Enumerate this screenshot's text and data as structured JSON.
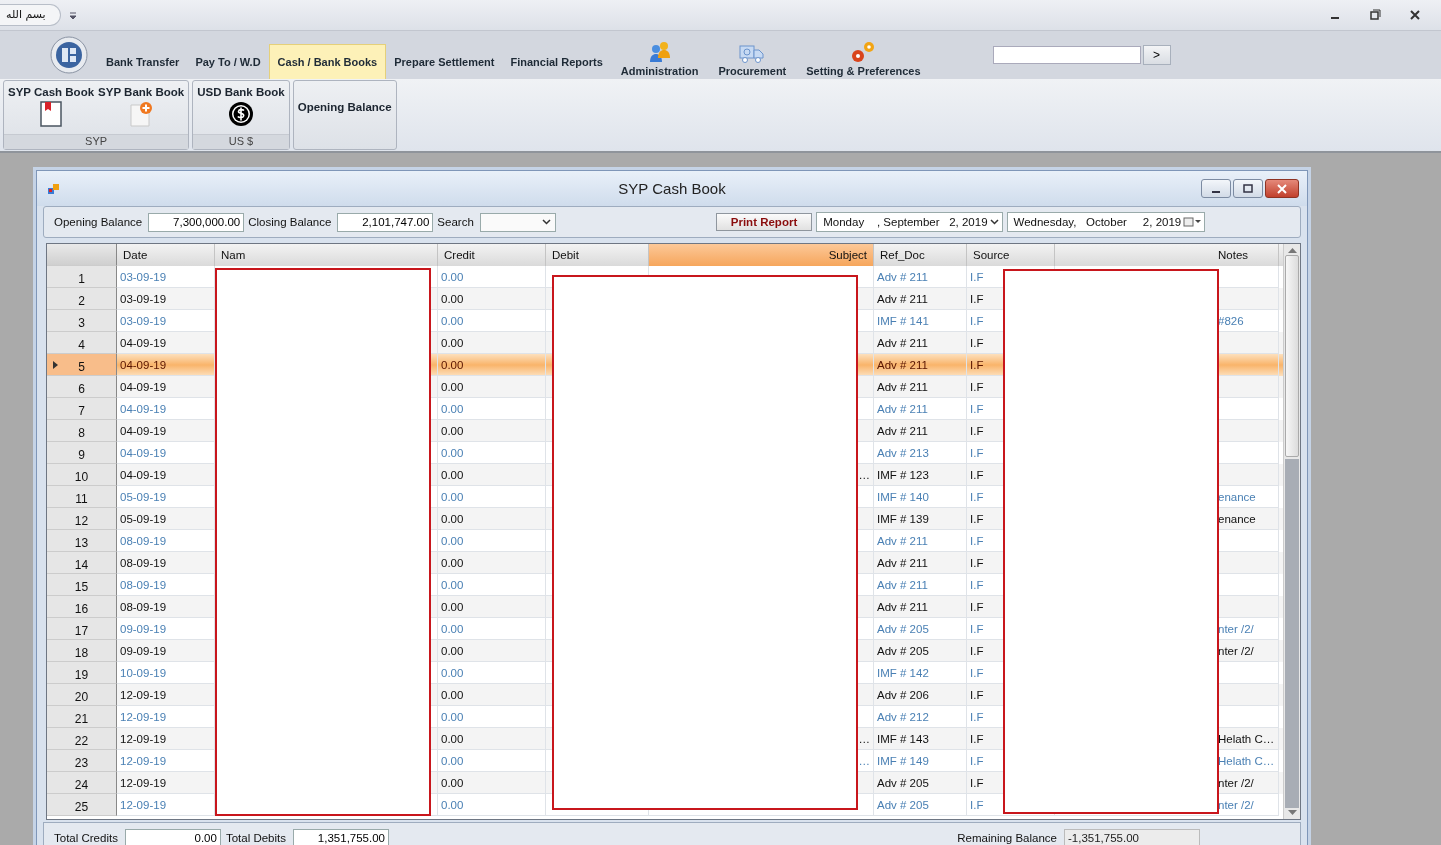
{
  "title_bar": {
    "quick_access": "بسم الله"
  },
  "ribbon": {
    "tabs": [
      {
        "label": "Bank Transfer",
        "selected": false,
        "kind": "text"
      },
      {
        "label": "Pay To / W.D",
        "selected": false,
        "kind": "text"
      },
      {
        "label": "Cash  / Bank Books",
        "selected": true,
        "kind": "text"
      },
      {
        "label": "Prepare Settlement",
        "selected": false,
        "kind": "text"
      },
      {
        "label": "Financial Reports",
        "selected": false,
        "kind": "text"
      },
      {
        "label": "Administration",
        "selected": false,
        "kind": "people"
      },
      {
        "label": "Procurement",
        "selected": false,
        "kind": "truck"
      },
      {
        "label": "Setting & Preferences",
        "selected": false,
        "kind": "gears"
      }
    ],
    "search_button": ">",
    "groups": [
      {
        "caption": "SYP",
        "buttons": [
          {
            "label": "SYP Cash Book",
            "kind": "book"
          },
          {
            "label": "SYP Bank Book",
            "kind": "page"
          }
        ]
      },
      {
        "caption": "US $",
        "buttons": [
          {
            "label": "USD Bank Book",
            "kind": "coin"
          }
        ]
      },
      {
        "buttons": [
          {
            "label": "Opening Balance",
            "kind": "text"
          }
        ]
      }
    ]
  },
  "child_window": {
    "title": "SYP Cash Book",
    "toolbar": {
      "opening_label": "Opening Balance",
      "opening_value": "7,300,000.00",
      "closing_label": "Closing  Balance",
      "closing_value": "2,101,747.00",
      "search_label": "Search",
      "print_button": "Print Report",
      "from_date": "Monday    , September   2, 2019",
      "to_date": "Wednesday,   October     2, 2019"
    },
    "columns": [
      {
        "label": "Date",
        "selected": false
      },
      {
        "label": "Nam",
        "selected": false
      },
      {
        "label": "Credit",
        "selected": false
      },
      {
        "label": "Debit",
        "selected": false
      },
      {
        "label": "Subject",
        "selected": true
      },
      {
        "label": "Ref_Doc",
        "selected": false
      },
      {
        "label": "Source",
        "selected": false
      },
      {
        "label": "Notes",
        "selected": false
      }
    ],
    "rows": [
      {
        "number": "1",
        "date": "03-09-19",
        "credit": "0.00",
        "ref_doc": "Adv # 211",
        "source": "I.F",
        "selected": false
      },
      {
        "number": "2",
        "date": "03-09-19",
        "credit": "0.00",
        "ref_doc": "Adv # 211",
        "source": "I.F",
        "selected": false
      },
      {
        "number": "3",
        "date": "03-09-19",
        "credit": "0.00",
        "ref_doc": "IMF # 141",
        "source": "I.F",
        "notes": "#826",
        "selected": false
      },
      {
        "number": "4",
        "date": "04-09-19",
        "credit": "0.00",
        "ref_doc": "Adv # 211",
        "source": "I.F",
        "selected": false
      },
      {
        "number": "5",
        "date": "04-09-19",
        "credit": "0.00",
        "ref_doc": "Adv # 211",
        "source": "I.F",
        "selected": true
      },
      {
        "number": "6",
        "date": "04-09-19",
        "credit": "0.00",
        "ref_doc": "Adv # 211",
        "source": "I.F",
        "selected": false
      },
      {
        "number": "7",
        "date": "04-09-19",
        "credit": "0.00",
        "ref_doc": "Adv # 211",
        "source": "I.F",
        "selected": false
      },
      {
        "number": "8",
        "date": "04-09-19",
        "credit": "0.00",
        "ref_doc": "Adv # 211",
        "source": "I.F",
        "selected": false
      },
      {
        "number": "9",
        "date": "04-09-19",
        "credit": "0.00",
        "ref_doc": "Adv # 213",
        "source": "I.F",
        "selected": false
      },
      {
        "number": "10",
        "date": "04-09-19",
        "credit": "0.00",
        "subject": "…",
        "ref_doc": "IMF # 123",
        "source": "I.F",
        "selected": false
      },
      {
        "number": "11",
        "date": "05-09-19",
        "credit": "0.00",
        "ref_doc": "IMF # 140",
        "source": "I.F",
        "notes": "enance",
        "selected": false
      },
      {
        "number": "12",
        "date": "05-09-19",
        "credit": "0.00",
        "ref_doc": "IMF # 139",
        "source": "I.F",
        "notes": "enance",
        "selected": false
      },
      {
        "number": "13",
        "date": "08-09-19",
        "credit": "0.00",
        "ref_doc": "Adv # 211",
        "source": "I.F",
        "selected": false
      },
      {
        "number": "14",
        "date": "08-09-19",
        "credit": "0.00",
        "ref_doc": "Adv # 211",
        "source": "I.F",
        "selected": false
      },
      {
        "number": "15",
        "date": "08-09-19",
        "credit": "0.00",
        "ref_doc": "Adv # 211",
        "source": "I.F",
        "selected": false
      },
      {
        "number": "16",
        "date": "08-09-19",
        "credit": "0.00",
        "ref_doc": "Adv # 211",
        "source": "I.F",
        "selected": false
      },
      {
        "number": "17",
        "date": "09-09-19",
        "credit": "0.00",
        "ref_doc": "Adv # 205",
        "source": "I.F",
        "notes": "nter /2/",
        "selected": false
      },
      {
        "number": "18",
        "date": "09-09-19",
        "credit": "0.00",
        "ref_doc": "Adv # 205",
        "source": "I.F",
        "notes": "nter /2/",
        "selected": false
      },
      {
        "number": "19",
        "date": "10-09-19",
        "credit": "0.00",
        "ref_doc": "IMF # 142",
        "source": "I.F",
        "selected": false
      },
      {
        "number": "20",
        "date": "12-09-19",
        "credit": "0.00",
        "ref_doc": "Adv # 206",
        "source": "I.F",
        "selected": false
      },
      {
        "number": "21",
        "date": "12-09-19",
        "credit": "0.00",
        "ref_doc": "Adv # 212",
        "source": "I.F",
        "selected": false
      },
      {
        "number": "22",
        "date": "12-09-19",
        "credit": "0.00",
        "subject": "…",
        "ref_doc": "IMF # 143",
        "source": "I.F",
        "notes": "Helath C…",
        "selected": false
      },
      {
        "number": "23",
        "date": "12-09-19",
        "credit": "0.00",
        "subject": "…",
        "ref_doc": "IMF # 149",
        "source": "I.F",
        "notes": "Helath C…",
        "selected": false
      },
      {
        "number": "24",
        "date": "12-09-19",
        "credit": "0.00",
        "ref_doc": "Adv # 205",
        "source": "I.F",
        "notes": "nter /2/",
        "selected": false
      },
      {
        "number": "25",
        "date": "12-09-19",
        "credit": "0.00",
        "ref_doc": "Adv # 205",
        "source": "I.F",
        "notes": "nter /2/",
        "selected": false
      }
    ],
    "footer": {
      "credits_label": "Total Credits",
      "credits_value": "0.00",
      "debits_label": "Total Debits",
      "debits_value": "1,351,755.00",
      "remaining_label": "Remaining Balance",
      "remaining_value": "-1,351,755.00"
    }
  }
}
